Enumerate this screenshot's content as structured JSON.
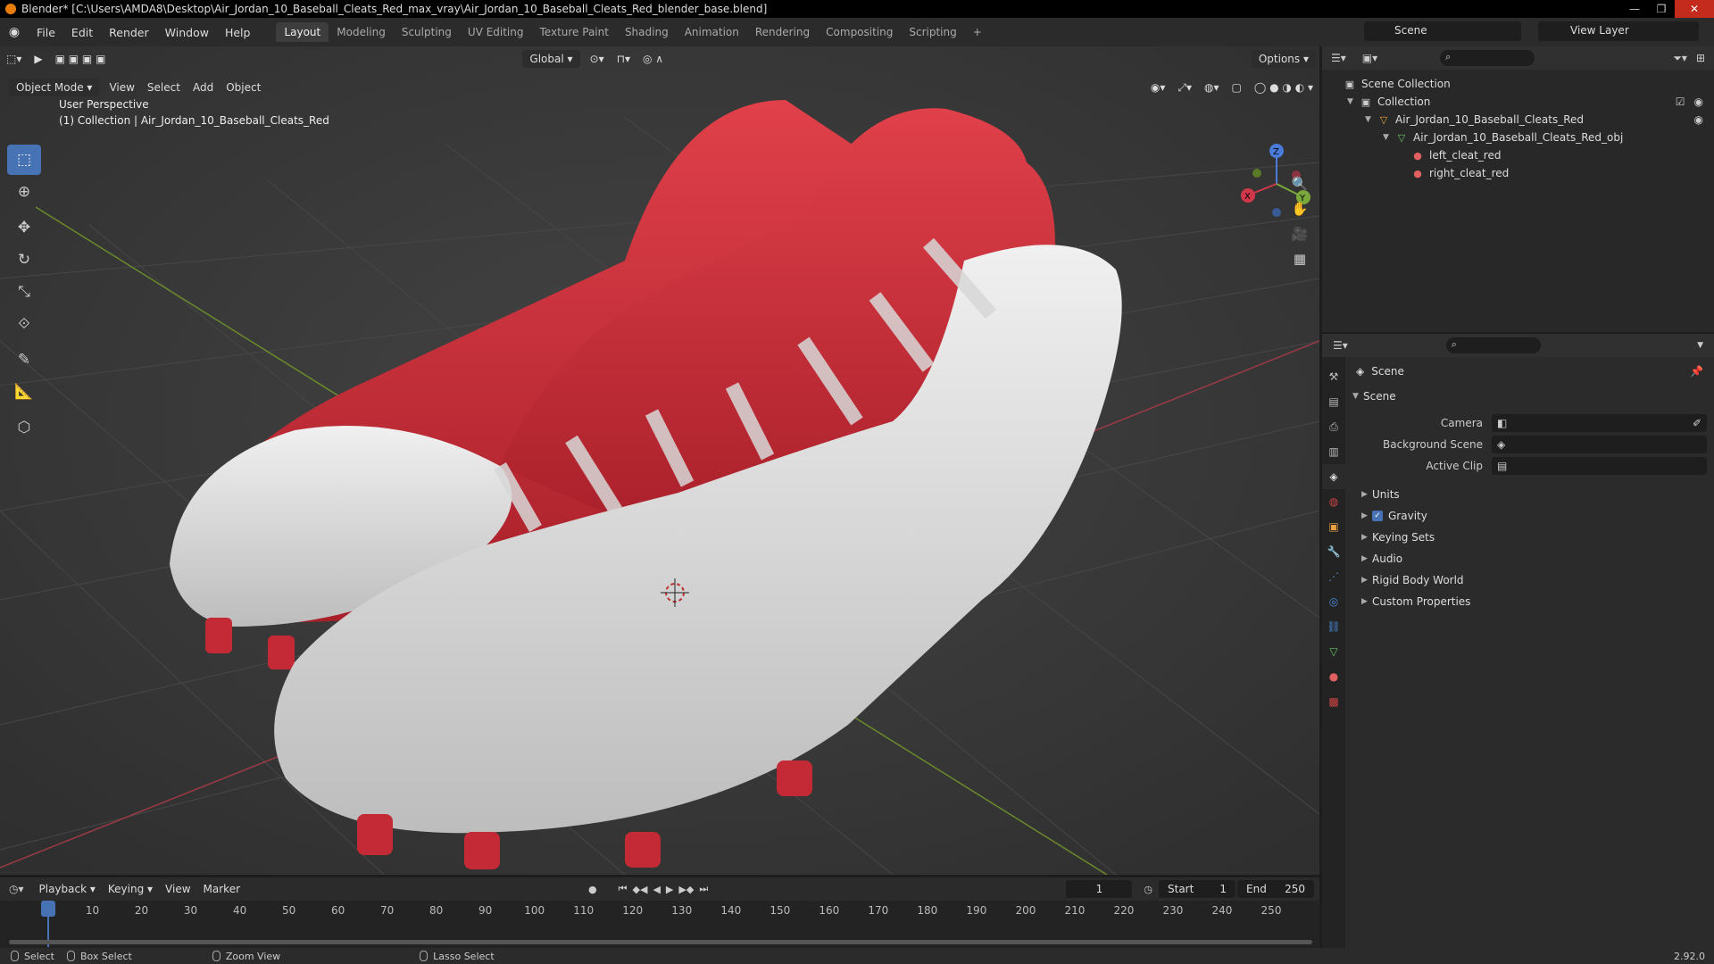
{
  "window": {
    "title": "Blender* [C:\\Users\\AMDA8\\Desktop\\Air_Jordan_10_Baseball_Cleats_Red_max_vray\\Air_Jordan_10_Baseball_Cleats_Red_blender_base.blend]",
    "minimize": "—",
    "maximize": "❐",
    "close": "✕"
  },
  "menu": {
    "items": [
      "File",
      "Edit",
      "Render",
      "Window",
      "Help"
    ],
    "workspaces": [
      "Layout",
      "Modeling",
      "Sculpting",
      "UV Editing",
      "Texture Paint",
      "Shading",
      "Animation",
      "Rendering",
      "Compositing",
      "Scripting"
    ],
    "active_workspace": "Layout",
    "add_workspace": "+",
    "scene": "Scene",
    "view_layer": "View Layer"
  },
  "viewport": {
    "mode": "Object Mode",
    "menus": [
      "View",
      "Select",
      "Add",
      "Object"
    ],
    "orientation": "Global",
    "options": "Options",
    "info_line1": "User Perspective",
    "info_line2": "(1) Collection | Air_Jordan_10_Baseball_Cleats_Red",
    "gizmo": {
      "x": "X",
      "y": "Y",
      "z": "Z"
    },
    "colors": {
      "bg": "#3a3a3a",
      "grid": "#454545",
      "x_axis": "#9b3b45",
      "y_axis": "#6b8a2a",
      "shoe_red": "#c42a35",
      "shoe_white": "#dcdcdc"
    }
  },
  "tools": [
    "select-box",
    "cursor",
    "move",
    "rotate",
    "scale",
    "transform",
    "annotate",
    "measure",
    "add-cube"
  ],
  "outliner": {
    "root": "Scene Collection",
    "collection": "Collection",
    "object": "Air_Jordan_10_Baseball_Cleats_Red",
    "mesh": "Air_Jordan_10_Baseball_Cleats_Red_obj",
    "materials": [
      "left_cleat_red",
      "right_cleat_red"
    ]
  },
  "properties": {
    "context": "Scene",
    "section": "Scene",
    "fields": [
      {
        "label": "Camera",
        "value": ""
      },
      {
        "label": "Background Scene",
        "value": ""
      },
      {
        "label": "Active Clip",
        "value": ""
      }
    ],
    "panels": [
      "Units",
      "Gravity",
      "Keying Sets",
      "Audio",
      "Rigid Body World",
      "Custom Properties"
    ],
    "gravity_enabled": true
  },
  "timeline": {
    "menus": [
      "Playback",
      "Keying",
      "View",
      "Marker"
    ],
    "current_frame": "1",
    "start_label": "Start",
    "start": "1",
    "end_label": "End",
    "end": "250",
    "ticks": [
      "1",
      "10",
      "20",
      "30",
      "40",
      "50",
      "60",
      "70",
      "80",
      "90",
      "100",
      "110",
      "120",
      "130",
      "140",
      "150",
      "160",
      "170",
      "180",
      "190",
      "200",
      "210",
      "220",
      "230",
      "240",
      "250"
    ]
  },
  "status": {
    "select": "Select",
    "box_select": "Box Select",
    "zoom_view": "Zoom View",
    "lasso_select": "Lasso Select",
    "version": "2.92.0"
  }
}
